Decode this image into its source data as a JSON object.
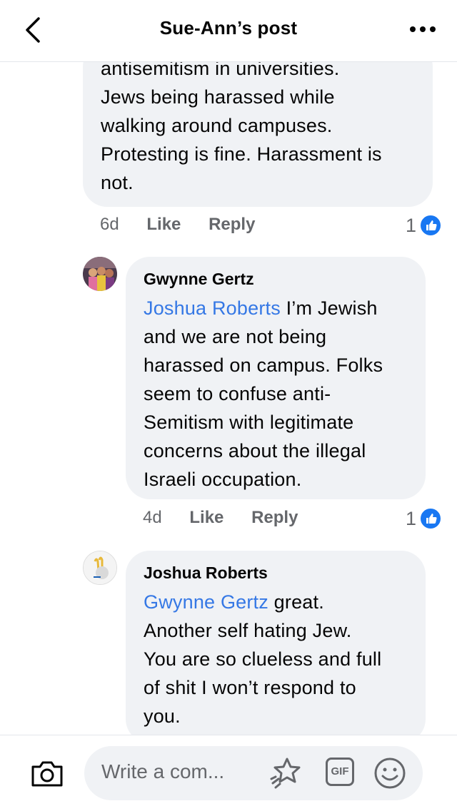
{
  "header": {
    "title": "Sue-Ann’s post",
    "back_icon": "chevron-left-icon",
    "more_icon": "more-dots-icon"
  },
  "comments": [
    {
      "text_lines": [
        "antisemitism in universities.",
        "Jews being harassed while",
        "walking around campuses.",
        "Protesting is fine. Harassment is",
        "not."
      ],
      "meta": {
        "time": "6d",
        "like": "Like",
        "reply": "Reply",
        "reaction_count": "1"
      }
    },
    {
      "author": "Gwynne Gertz",
      "mention": "Joshua Roberts",
      "text_lines": [
        " I’m Jewish",
        "and we are not being",
        "harassed on campus. Folks",
        "seem to confuse anti-",
        "Semitism with legitimate",
        "concerns about the illegal",
        "Israeli occupation."
      ],
      "meta": {
        "time": "4d",
        "like": "Like",
        "reply": "Reply",
        "reaction_count": "1"
      }
    },
    {
      "author": "Joshua Roberts",
      "mention": "Gwynne Gertz",
      "text_lines": [
        " great.",
        "Another self hating Jew.",
        "You are so clueless and full",
        "of shit I won’t respond to",
        "you."
      ]
    }
  ],
  "composer": {
    "placeholder": "Write a com...",
    "gif_label": "GIF",
    "camera_icon": "camera-icon",
    "sticker_icon": "sticker-icon",
    "emoji_icon": "emoji-icon"
  },
  "colors": {
    "bubble": "#f0f2f5",
    "mention": "#3578e5",
    "like_blue": "#1877f2",
    "secondary_text": "#65676b"
  }
}
